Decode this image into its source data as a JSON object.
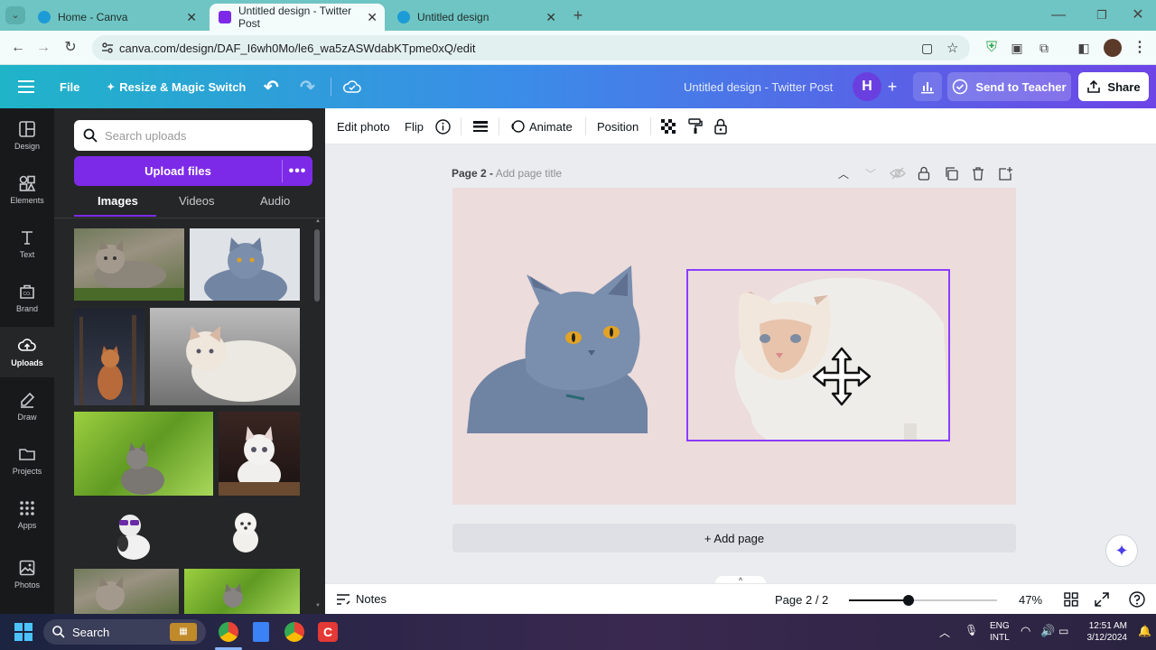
{
  "browser": {
    "tabs": [
      {
        "title": "Home - Canva",
        "active": false
      },
      {
        "title": "Untitled design - Twitter Post",
        "active": true
      },
      {
        "title": "Untitled design",
        "active": false
      }
    ],
    "url": "canva.com/design/DAF_I6wh0Mo/le6_wa5zASWdabKTpme0xQ/edit"
  },
  "header": {
    "menu_file": "File",
    "resize_label": "Resize & Magic Switch",
    "doc_title": "Untitled design - Twitter Post",
    "avatar_letter": "H",
    "send_label": "Send to Teacher",
    "share_label": "Share",
    "accent": "#7d2ae8"
  },
  "rail": {
    "items": [
      {
        "label": "Design",
        "icon": "design-icon"
      },
      {
        "label": "Elements",
        "icon": "elements-icon"
      },
      {
        "label": "Text",
        "icon": "text-icon"
      },
      {
        "label": "Brand",
        "icon": "brand-icon"
      },
      {
        "label": "Uploads",
        "icon": "uploads-icon",
        "active": true
      },
      {
        "label": "Draw",
        "icon": "draw-icon"
      },
      {
        "label": "Projects",
        "icon": "projects-icon"
      },
      {
        "label": "Apps",
        "icon": "apps-icon"
      },
      {
        "label": "Photos",
        "icon": "photos-icon"
      }
    ]
  },
  "panel": {
    "search_placeholder": "Search uploads",
    "upload_label": "Upload files",
    "tabs": [
      {
        "label": "Images",
        "active": true
      },
      {
        "label": "Videos"
      },
      {
        "label": "Audio"
      }
    ]
  },
  "toolbar": {
    "edit_photo": "Edit photo",
    "flip": "Flip",
    "animate": "Animate",
    "position": "Position"
  },
  "canvas": {
    "page_label": "Page 2 -",
    "page_title_placeholder": "Add page title",
    "add_page": "+ Add page"
  },
  "footer": {
    "notes": "Notes",
    "page_indicator": "Page 2 / 2",
    "zoom": "47%",
    "zoom_fraction": 0.4
  },
  "taskbar": {
    "search": "Search",
    "lang1": "ENG",
    "lang2": "INTL",
    "time": "12:51 AM",
    "date": "3/12/2024"
  }
}
